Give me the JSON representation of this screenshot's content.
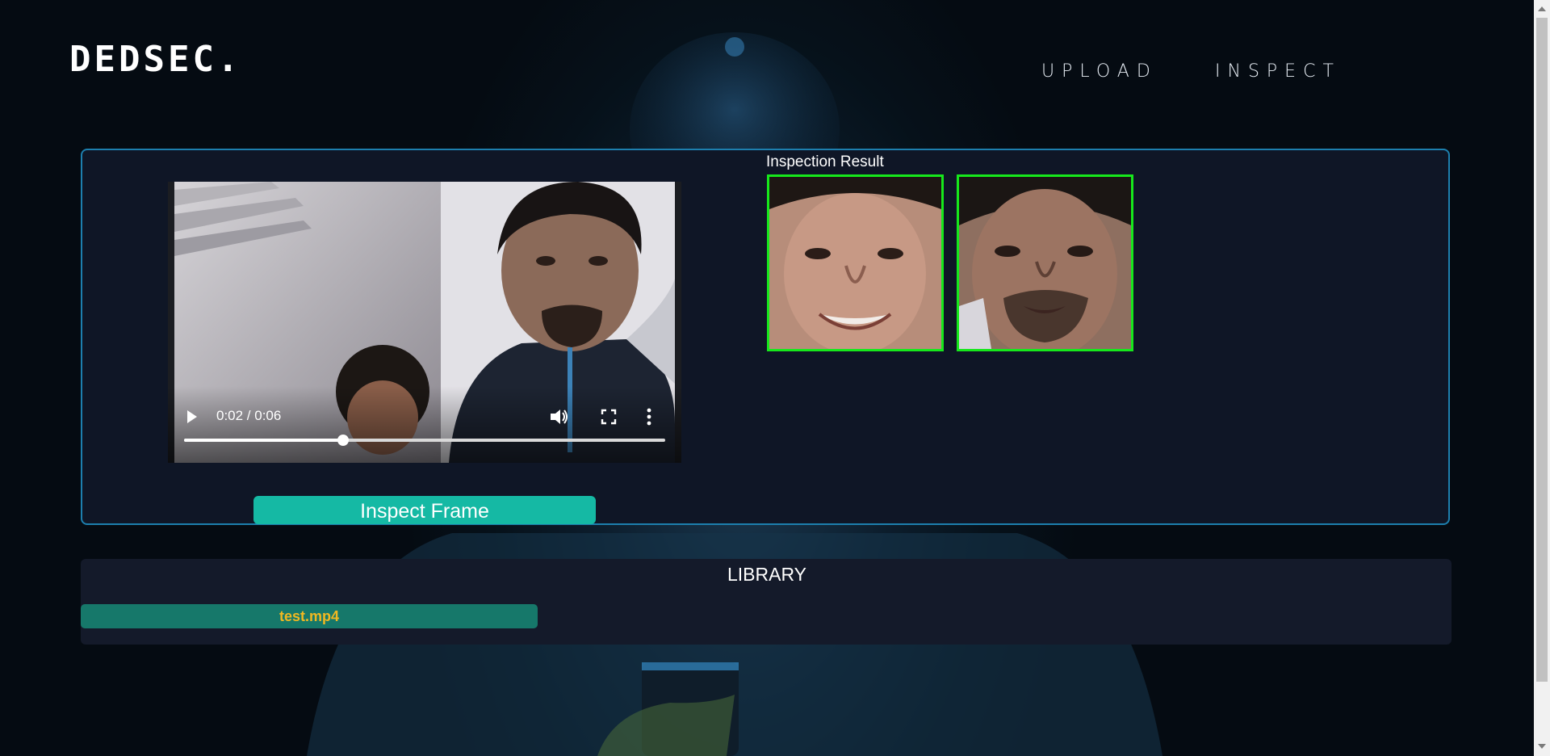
{
  "brand": {
    "logo": "DEDSEC."
  },
  "nav": {
    "upload": "UPLOAD",
    "inspect": "INSPECT"
  },
  "player": {
    "current_time": "0:02",
    "duration": "0:06",
    "time_label": "0:02 / 0:06",
    "progress": 0.33,
    "play_icon": "play-icon",
    "volume_icon": "volume-icon",
    "fullscreen_icon": "fullscreen-icon",
    "more_icon": "more-vertical-icon"
  },
  "actions": {
    "inspect_frame": "Inspect Frame"
  },
  "results": {
    "title": "Inspection Result",
    "faces": [
      {
        "id": "face-1",
        "border_color": "#16e81c"
      },
      {
        "id": "face-2",
        "border_color": "#16e81c"
      }
    ]
  },
  "library": {
    "title": "LIBRARY",
    "items": [
      {
        "name": "test.mp4"
      }
    ]
  },
  "colors": {
    "accent": "#15b9a4",
    "panel_border": "#1d7fae",
    "library_item": "#16786a",
    "library_item_text": "#f0b821",
    "face_border": "#16e81c"
  }
}
